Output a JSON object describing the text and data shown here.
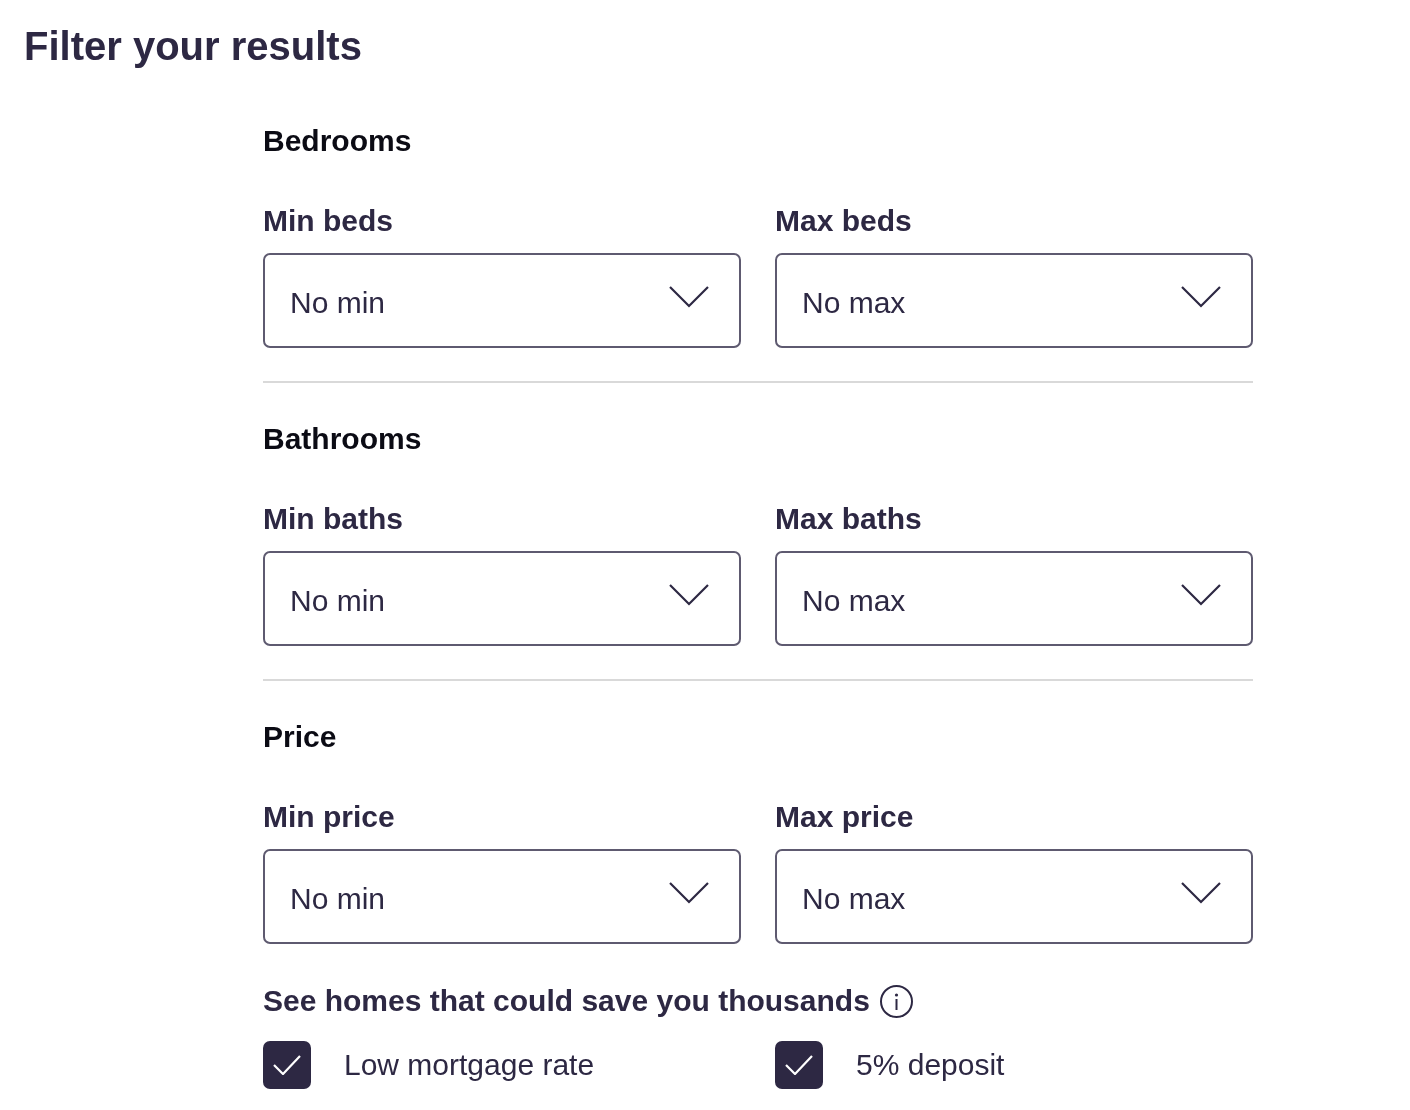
{
  "title": "Filter your results",
  "sections": [
    {
      "heading": "Bedrooms",
      "selects": [
        {
          "label": "Min beds",
          "value": "No min"
        },
        {
          "label": "Max beds",
          "value": "No max"
        }
      ]
    },
    {
      "heading": "Bathrooms",
      "selects": [
        {
          "label": "Min baths",
          "value": "No min"
        },
        {
          "label": "Max baths",
          "value": "No max"
        }
      ]
    },
    {
      "heading": "Price",
      "selects": [
        {
          "label": "Min price",
          "value": "No min"
        },
        {
          "label": "Max price",
          "value": "No max"
        }
      ]
    }
  ],
  "savings": {
    "heading": "See homes that could save you thousands",
    "options": [
      {
        "label": "Low mortgage rate",
        "checked": true
      },
      {
        "label": "5% deposit",
        "checked": true
      }
    ]
  }
}
